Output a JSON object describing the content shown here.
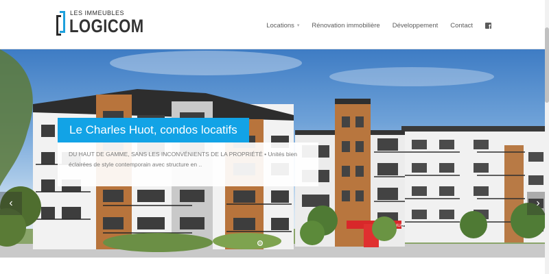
{
  "brand": {
    "tagline": "LES IMMEUBLES",
    "name": "LOGICOM",
    "colors": {
      "blue": "#1ea0dc",
      "dark": "#2b2b2b"
    }
  },
  "nav": {
    "items": [
      {
        "label": "Locations",
        "has_dropdown": true
      },
      {
        "label": "Rénovation immobilière"
      },
      {
        "label": "Développement"
      },
      {
        "label": "Contact"
      }
    ],
    "social_icon": "facebook-icon"
  },
  "slider": {
    "caption_title": "Le Charles Huot, condos locatifs",
    "caption_text": "DU HAUT DE GAMME, SANS LES INCONVÉNIENTS DE LA PROPRIÉTÉ • Unités bien éclairées de style contemporain avec structure en ..",
    "building_sign": "CHARLES HUOT",
    "prev_icon": "chevron-left-icon",
    "next_icon": "chevron-right-icon",
    "slide_count": 1,
    "active_slide": 1,
    "accent_color": "#12a3e6"
  }
}
